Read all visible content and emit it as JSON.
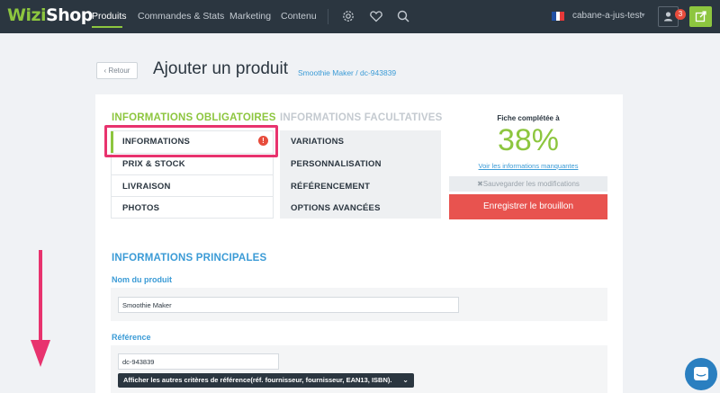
{
  "brand": {
    "part1": "Wizi",
    "part2": "Shop"
  },
  "nav": {
    "items": [
      "Produits",
      "Commandes & Stats",
      "Marketing",
      "Contenu"
    ],
    "active": "Produits"
  },
  "topbar": {
    "store": "cabane-a-jus-test",
    "notification_count": "3"
  },
  "header": {
    "back_label": "Retour",
    "title": "Ajouter un produit",
    "subtitle": "Smoothie Maker / dc-943839"
  },
  "sections": {
    "required_title": "INFORMATIONS OBLIGATOIRES",
    "optional_title": "INFORMATIONS FACULTATIVES",
    "required_tabs": [
      "INFORMATIONS",
      "PRIX & STOCK",
      "LIVRAISON",
      "PHOTOS"
    ],
    "optional_tabs": [
      "VARIATIONS",
      "PERSONNALISATION",
      "RÉFÉRENCEMENT",
      "OPTIONS AVANCÉES"
    ]
  },
  "completion": {
    "label": "Fiche complétée à",
    "percent": "38%",
    "missing_link": "Voir les informations manquantes",
    "save_label": "Sauvegarder les modifications",
    "draft_label": "Enregistrer le brouillon"
  },
  "form": {
    "main_title": "INFORMATIONS PRINCIPALES",
    "name_label": "Nom du produit",
    "name_value": "Smoothie Maker",
    "ref_label": "Référence",
    "ref_value": "dc-943839",
    "more_criteria_label": "Afficher les autres critères de référence(réf. fournisseur, fournisseur, EAN13, ISBN)."
  },
  "colors": {
    "brand_green": "#8dc63f",
    "accent_blue": "#3b9bd6",
    "danger": "#e8534f",
    "highlight_pink": "#e8336e",
    "topbar": "#2b3640"
  },
  "icons": [
    "gear-icon",
    "heart-icon",
    "search-icon",
    "user-icon",
    "external-link-icon",
    "alert-icon",
    "chat-icon"
  ]
}
